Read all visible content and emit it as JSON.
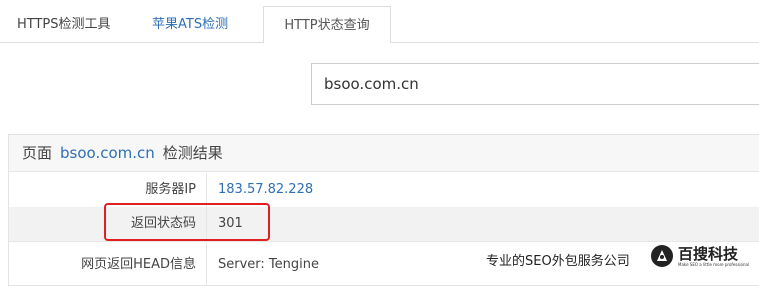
{
  "tabs": [
    {
      "label": "HTTPS检测工具"
    },
    {
      "label": "苹果ATS检测"
    },
    {
      "label": "HTTP状态查询"
    }
  ],
  "search": {
    "value": "bsoo.com.cn"
  },
  "result": {
    "header_prefix": "页面",
    "header_domain": "bsoo.com.cn",
    "header_suffix": "检测结果",
    "rows": [
      {
        "label": "服务器IP",
        "value": "183.57.82.228"
      },
      {
        "label": "返回状态码",
        "value": "301"
      },
      {
        "label": "网页返回HEAD信息",
        "value": "Server: Tengine"
      }
    ]
  },
  "watermark": {
    "text": "专业的SEO外包服务公司",
    "logo_text": "百搜科技",
    "logo_sub": "Make SEO a little more professional"
  },
  "colors": {
    "link": "#2e6fb6",
    "highlight": "#e02020",
    "header_bg": "#f7f7f7"
  }
}
